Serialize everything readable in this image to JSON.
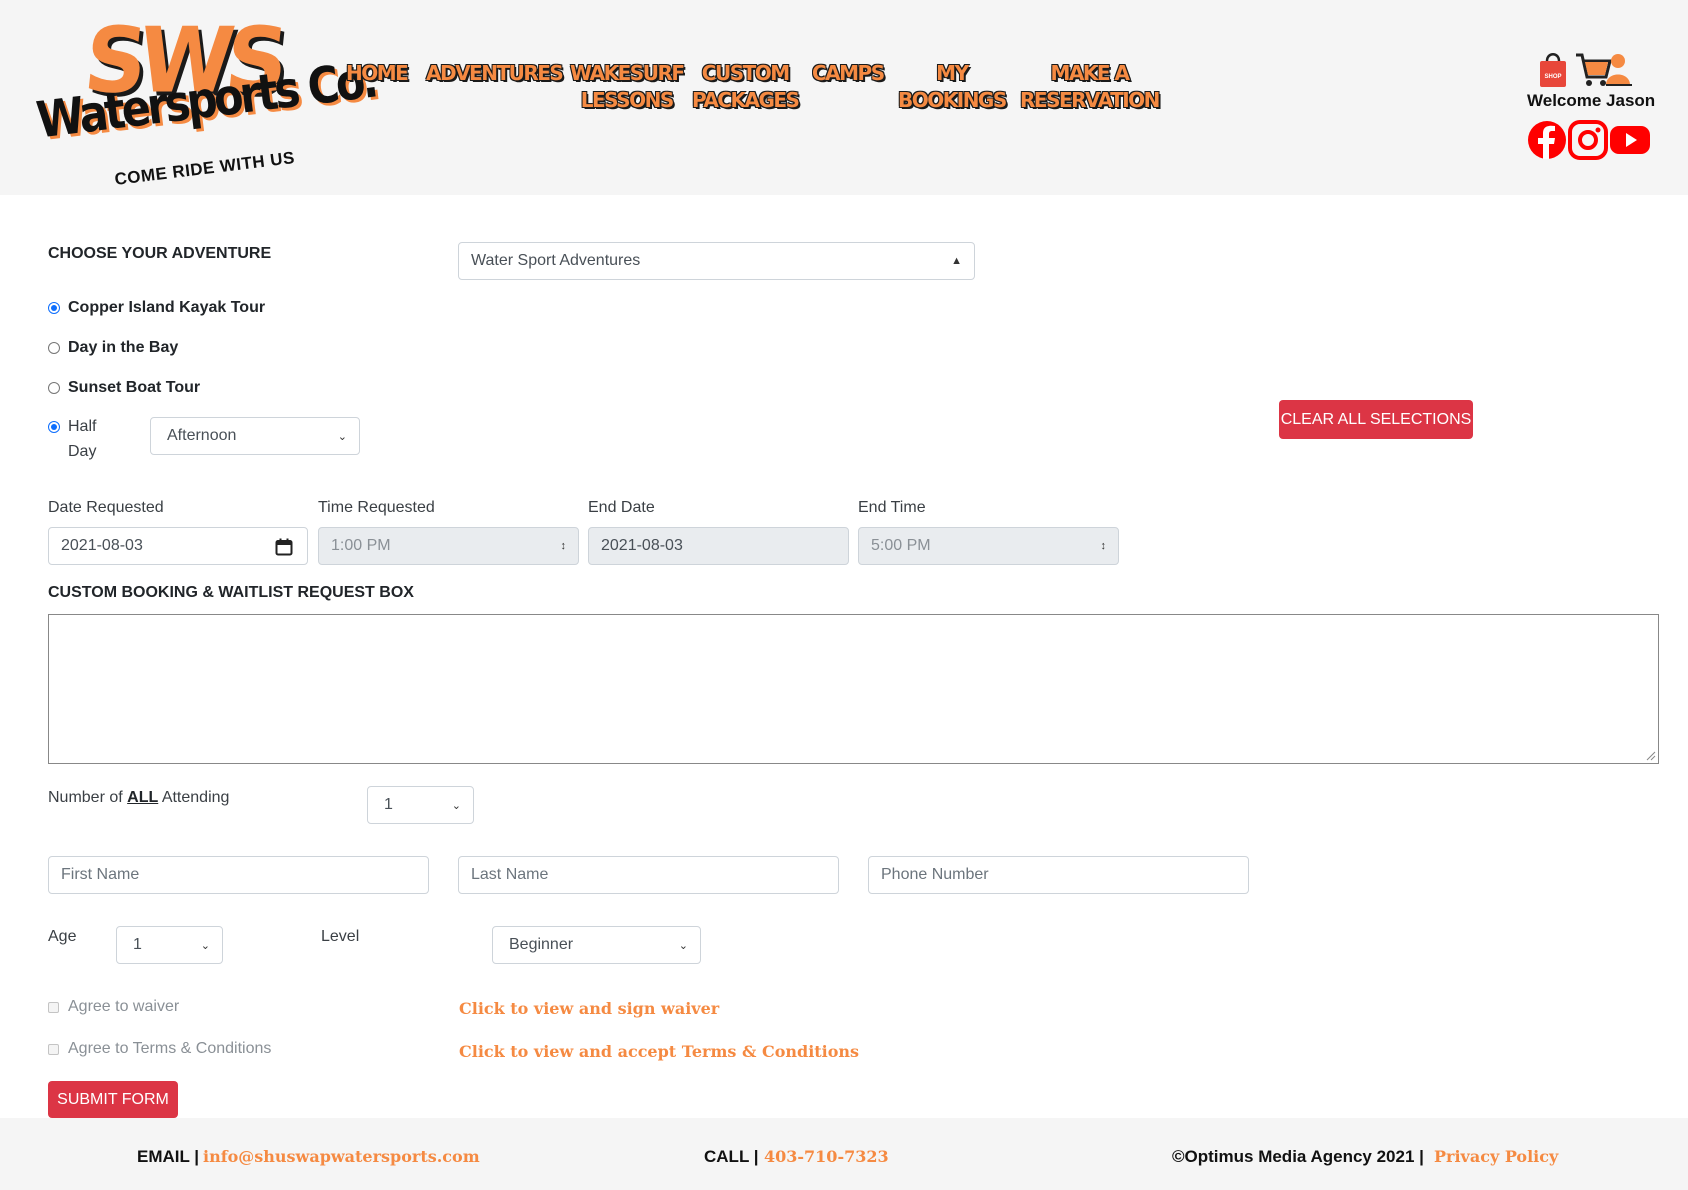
{
  "header": {
    "logo": {
      "brand": "SWS",
      "name": "Watersports Co.",
      "tagline": "COME RIDE WITH US"
    },
    "nav": [
      {
        "line1": "HOME",
        "line2": ""
      },
      {
        "line1": "ADVENTURES",
        "line2": ""
      },
      {
        "line1": "WAKESURF",
        "line2": "LESSONS"
      },
      {
        "line1": "CUSTOM",
        "line2": "PACKAGES"
      },
      {
        "line1": "CAMPS",
        "line2": ""
      },
      {
        "line1": "MY",
        "line2": "BOOKINGS"
      },
      {
        "line1": "MAKE A",
        "line2": "RESERVATION"
      }
    ],
    "shop_label": "SHOP",
    "welcome": "Welcome Jason",
    "social_icons": [
      "facebook-icon",
      "instagram-icon",
      "youtube-icon"
    ]
  },
  "form": {
    "choose_label": "CHOOSE YOUR ADVENTURE",
    "adventure_select": "Water Sport Adventures",
    "radios": [
      {
        "label": "Copper Island Kayak Tour",
        "checked": true
      },
      {
        "label": "Day in the Bay",
        "checked": false
      },
      {
        "label": "Sunset Boat Tour",
        "checked": false
      }
    ],
    "duration": {
      "label_line1": "Half",
      "label_line2": "Day",
      "checked": true,
      "select": "Afternoon"
    },
    "clear_button": "CLEAR ALL SELECTIONS",
    "date_requested": {
      "label": "Date Requested",
      "value": "2021-08-03"
    },
    "time_requested": {
      "label": "Time Requested",
      "value": "1:00 PM"
    },
    "end_date": {
      "label": "End Date",
      "value": "2021-08-03"
    },
    "end_time": {
      "label": "End Time",
      "value": "5:00 PM"
    },
    "request_box_label": "CUSTOM BOOKING & WAITLIST REQUEST BOX",
    "attending": {
      "label_pre": "Number of ",
      "label_bold": "ALL",
      "label_post": " Attending",
      "value": "1"
    },
    "first_name_placeholder": "First Name",
    "last_name_placeholder": "Last Name",
    "phone_placeholder": "Phone Number",
    "age": {
      "label": "Age",
      "value": "1"
    },
    "level": {
      "label": "Level",
      "value": "Beginner"
    },
    "waiver": {
      "label": "Agree to waiver",
      "link": "Click to view and sign waiver"
    },
    "terms": {
      "label": "Agree to Terms & Conditions",
      "link": "Click to view and accept Terms & Conditions"
    },
    "submit_button": "SUBMIT FORM"
  },
  "footer": {
    "email_label": "EMAIL |",
    "email": "info@shuswapwatersports.com",
    "call_label": "CALL |",
    "phone": "403-710-7323",
    "copyright": "©Optimus Media Agency 2021 |",
    "privacy": "Privacy Policy"
  },
  "colors": {
    "brand_orange": "#f58a42",
    "danger_red": "#dc3545",
    "radio_blue": "#0d6efd",
    "header_bg": "#f5f5f5"
  }
}
